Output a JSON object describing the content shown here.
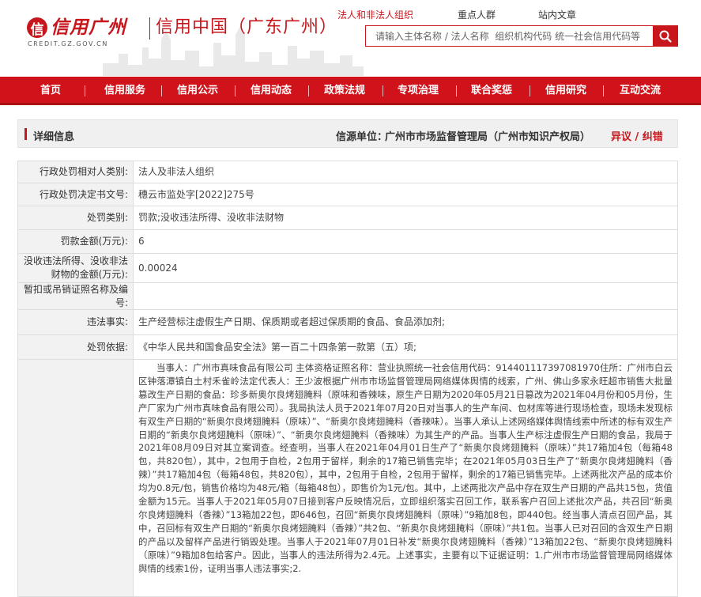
{
  "header": {
    "logo_mark": "信",
    "logo_cn": "信用广州",
    "logo_en": "CREDIT.GZ.GOV.CN",
    "site_name": "信用中国（广东广州）",
    "top_links": [
      "法人和非法人组织",
      "重点人群",
      "站内文章"
    ],
    "search_placeholder": "请输入主体名称 / 法人名称  组织机构代码 统一社会信用代码等"
  },
  "nav": [
    "首页",
    "信用服务",
    "信用公示",
    "信用动态",
    "政策法规",
    "专项治理",
    "联合奖惩",
    "信用研究",
    "互动交流"
  ],
  "detail": {
    "title": "详细信息",
    "source_label": "信源单位：",
    "source_value": "广州市市场监督管理局（广州市知识产权局）",
    "error_link": "异议 / 纠错"
  },
  "rows": [
    {
      "label": "行政处罚相对人类别:",
      "value": "法人及非法人组织"
    },
    {
      "label": "行政处罚决定书文号:",
      "value": "穗云市监处字[2022]275号"
    },
    {
      "label": "处罚类别:",
      "value": "罚款;没收违法所得、没收非法财物"
    },
    {
      "label": "罚款金额(万元):",
      "value": "6"
    },
    {
      "label": "没收违法所得、没收非法财物的金额(万元):",
      "value": "0.00024"
    },
    {
      "label": "暂扣或吊销证照名称及编号:",
      "value": ""
    },
    {
      "label": "违法事实:",
      "value": "生产经营标注虚假生产日期、保质期或者超过保质期的食品、食品添加剂;"
    },
    {
      "label": "处罚依据:",
      "value": "《中华人民共和国食品安全法》第一百二十四条第一款第（五）项;"
    },
    {
      "label": "",
      "value": "当事人：广州市真味食品有限公司 主体资格证照名称：营业执照统一社会信用代码：91440111739708197​0住所：广州市白云区钟落潭镇白土村禾雀岭法定代表人：王少波根据广州市市场监督管理局网络媒体舆情的线索，广州、佛山多家永旺超市销售大批量篡改生产日期的食品：珍多新奥尔良烤翅腌料（原味和香辣味，原生产日期为2020年05月21日篡改为2021年04月份和05月份，生产厂家为广州市真味食品有限公司）。我局执法人员于2021年07月20日对当事人的生产车间、包材库等进行现场检查，现场未发现标有双生产日期的“新奥尔良烤翅腌料（原味）”、“新奥尔良烤翅腌料（香辣味）。当事人承认上述网络媒体舆情线索中所述的标有双生产日期的“新奥尔良烤翅腌料（原味）”、“新奥尔良烤翅腌料（香辣味）为其生产的产品。当事人生产标注虚假生产日期的食品，我局于2021年08月09日对其立案调查。经查明，当事人在2021年04月01日生产了“新奥尔良烤翅腌料（原味）”共17箱加4包（每箱48包，共820包），其中，2包用于自检，2包用于留样，剩余的17箱已销售完毕；在2021年05月03日生产了“新奥尔良烤翅腌料（香辣）”共17箱加4包（每箱48包，共820包），其中，2包用于自检，2包用于留样，剩余的17箱已销售完毕。上述两批次产品的成本价均为0.8元/包，销售价格均为48元/箱（每箱48包），即售价为1元/包。其中，上述两批次产品中存在双生产日期的产品共15包，货值金额为15元。当事人于2021年05月07日接到客户反映情况后，立即组织落实召回工作，联系客户召回上述批次产品，共召回“新奥尔良烤翅腌料（香辣）”13箱加22包，即646包，召回“新奥尔良烤翅腌料（原味）”9箱加8包，即440包。经当事人清点召回产品，其中，召回标有双生产日期的“新奥尔良烤翅腌料（香辣）”共2包、“新奥尔良烤翅腌料（原味）”共1包。当事人已对召回的含双生产日期的产品以及留样产品进行销毁处理。当事人于2021年07月01日补发“新奥尔良烤翅腌料（香辣）”13箱加22包、“新奥尔良烤翅腌料（原味）”9箱加8包给客户。因此，当事人的违法所得为2.4元。上述事实，主要有以下证据证明：1.广州市市场监督管理局网络媒体舆情的线索1份，证明当事人违法事实;2."
    }
  ],
  "colors": {
    "brand_red": "#c8161d",
    "nav_red": "#d0131b"
  }
}
